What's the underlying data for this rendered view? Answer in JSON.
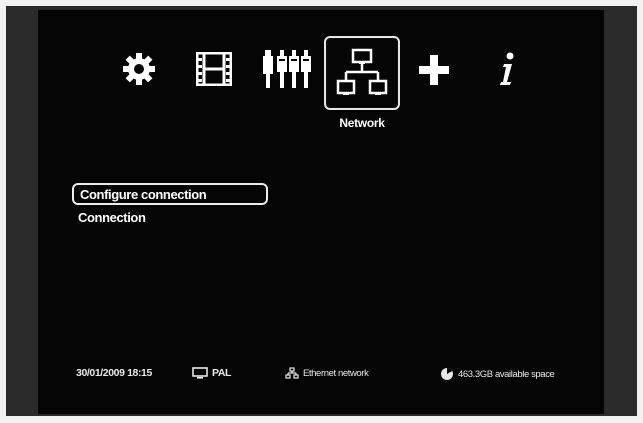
{
  "tabs": [
    {
      "icon": "gear-icon"
    },
    {
      "icon": "film-icon"
    },
    {
      "icon": "av-cables-icon"
    },
    {
      "icon": "network-icon",
      "label": "Network",
      "selected": true
    },
    {
      "icon": "plus-icon"
    },
    {
      "icon": "info-icon"
    }
  ],
  "menu": {
    "items": [
      {
        "label": "Configure connection",
        "selected": true
      },
      {
        "label": "Connection",
        "selected": false
      }
    ]
  },
  "status_bar": {
    "datetime": "30/01/2009 18:15",
    "tv_standard": "PAL",
    "network": "Ethernet network",
    "disk_space": "463.3GB available space"
  },
  "colors": {
    "background": "#050505",
    "frame": "#2b2b2b",
    "text": "#ffffff"
  }
}
